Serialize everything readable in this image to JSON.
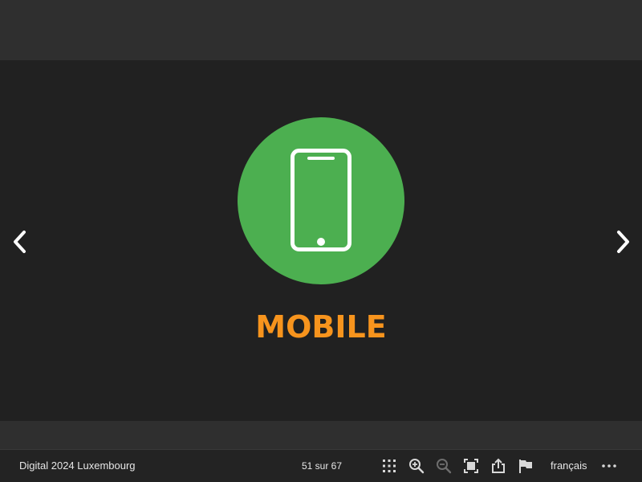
{
  "slide": {
    "title": "MOBILE",
    "title_color": "#f7941d",
    "circle_color": "#4caf50",
    "icon": "smartphone-icon"
  },
  "navigation": {
    "prev_icon": "chevron-left-icon",
    "next_icon": "chevron-right-icon"
  },
  "toolbar": {
    "document_title": "Digital 2024 Luxembourg",
    "page_indicator": "51 sur 67",
    "icons": [
      "grid-icon",
      "zoom-in-icon",
      "zoom-out-icon",
      "fullscreen-icon",
      "share-icon",
      "flag-icon",
      "more-icon"
    ],
    "zoom_out_disabled": true,
    "language": "français"
  }
}
